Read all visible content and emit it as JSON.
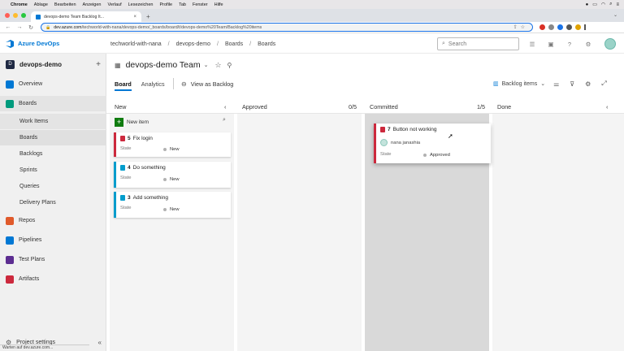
{
  "mac_menu": {
    "app": "Chrome",
    "items": [
      "Ablage",
      "Bearbeiten",
      "Anzeigen",
      "Verlauf",
      "Lesezeichen",
      "Profile",
      "Tab",
      "Fenster",
      "Hilfe"
    ]
  },
  "browser": {
    "tab_title": "devops-demo Team Backlog It...",
    "url_domain": "dev.azure.com",
    "url_path": "/techworld-with-nana/devops-demo/_boards/board/t/devops-demo%20Team/Backlog%20items",
    "status_text": "Warten auf dev.azure.com..."
  },
  "header": {
    "brand": "Azure DevOps",
    "breadcrumbs": [
      "techworld-with-nana",
      "devops-demo",
      "Boards",
      "Boards"
    ],
    "search_placeholder": "Search"
  },
  "sidebar": {
    "project_initial": "D",
    "project_name": "devops-demo",
    "items": [
      {
        "label": "Overview",
        "color": "#0078d4"
      },
      {
        "label": "Boards",
        "color": "#009b7d"
      },
      {
        "label": "Work Items"
      },
      {
        "label": "Boards"
      },
      {
        "label": "Backlogs"
      },
      {
        "label": "Sprints"
      },
      {
        "label": "Queries"
      },
      {
        "label": "Delivery Plans"
      },
      {
        "label": "Repos",
        "color": "#e05a2b"
      },
      {
        "label": "Pipelines",
        "color": "#0078d4"
      },
      {
        "label": "Test Plans",
        "color": "#5c2d91"
      },
      {
        "label": "Artifacts",
        "color": "#cc293d"
      }
    ],
    "settings_label": "Project settings"
  },
  "team": {
    "name": "devops-demo Team"
  },
  "pivots": {
    "board": "Board",
    "analytics": "Analytics",
    "view_as_backlog": "View as Backlog",
    "backlog_items": "Backlog items"
  },
  "board": {
    "new_item_label": "New item",
    "state_label": "State",
    "columns": [
      {
        "name": "New",
        "count": ""
      },
      {
        "name": "Approved",
        "count": "0/5"
      },
      {
        "name": "Committed",
        "count": "1/5"
      },
      {
        "name": "Done",
        "count": ""
      }
    ],
    "cards": [
      {
        "id": "5",
        "title": "Fix login",
        "state": "New",
        "type_color": "#cc293d",
        "state_color": "#b2b2b2"
      },
      {
        "id": "4",
        "title": "Do something",
        "state": "New",
        "type_color": "#009ccc",
        "state_color": "#b2b2b2"
      },
      {
        "id": "3",
        "title": "Add something",
        "state": "New",
        "type_color": "#009ccc",
        "state_color": "#b2b2b2"
      },
      {
        "id": "7",
        "title": "Button not working",
        "assignee": "nana janashia",
        "state": "Approved",
        "type_color": "#cc293d",
        "state_color": "#b2b2b2"
      }
    ]
  }
}
